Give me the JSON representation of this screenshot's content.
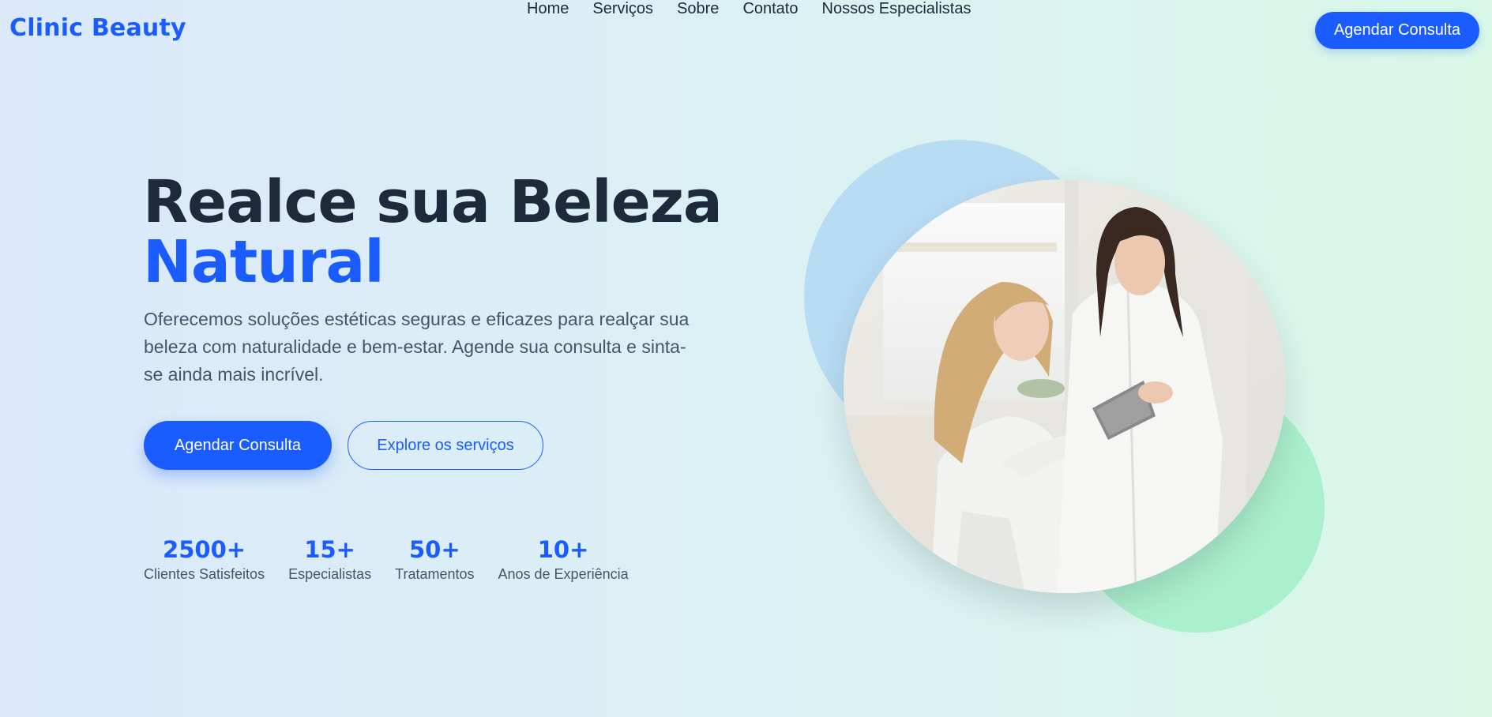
{
  "header": {
    "logo": "Clinic Beauty",
    "nav": [
      "Home",
      "Serviços",
      "Sobre",
      "Contato",
      "Nossos Especialistas"
    ],
    "cta_label": "Agendar Consulta"
  },
  "hero": {
    "title_line1": "Realce sua Beleza",
    "title_line2": "Natural",
    "description": "Oferecemos soluções estéticas seguras e eficazes para realçar sua beleza com naturalidade e bem-estar. Agende sua consulta e sinta-se ainda mais incrível.",
    "primary_button": "Agendar Consulta",
    "secondary_button": "Explore os serviços"
  },
  "stats": [
    {
      "value": "2500+",
      "label": "Clientes Satisfeitos"
    },
    {
      "value": "15+",
      "label": "Especialistas"
    },
    {
      "value": "50+",
      "label": "Tratamentos"
    },
    {
      "value": "10+",
      "label": "Anos de Experiência"
    }
  ],
  "colors": {
    "accent": "#1a5cff",
    "heading": "#1e293b",
    "body_text": "#475569",
    "blob_blue": "#b8dcf3",
    "blob_green": "#abf0cc"
  },
  "image": {
    "icon": "clinic-photo-icon"
  }
}
